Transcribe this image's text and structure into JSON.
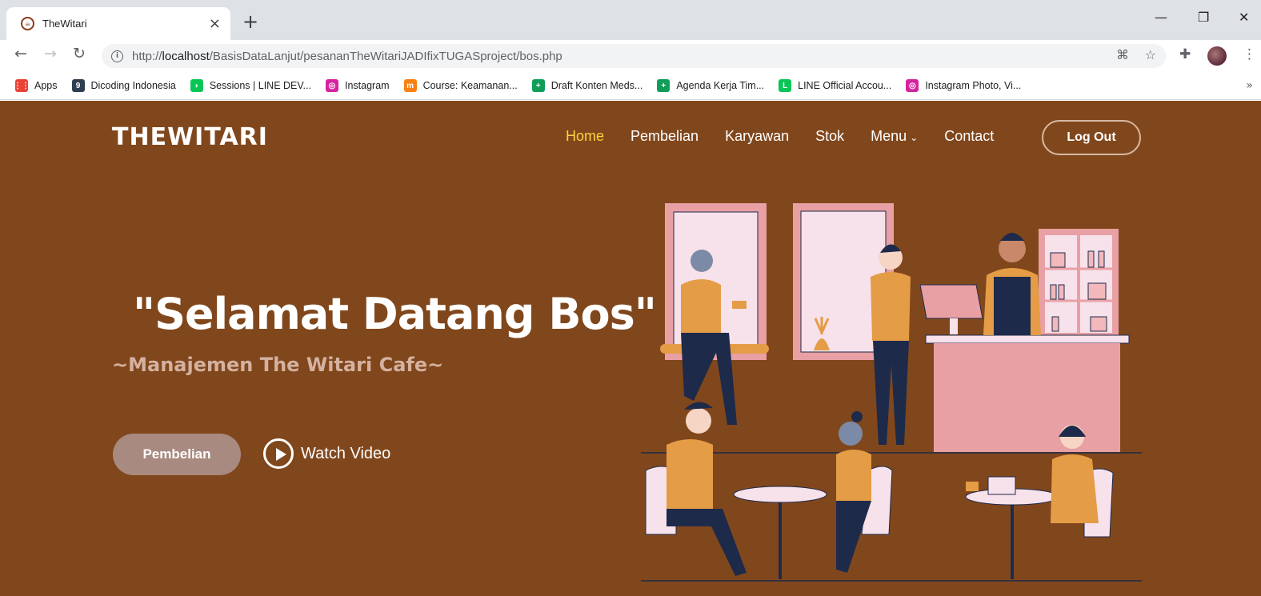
{
  "browser": {
    "tab": {
      "title": "TheWitari"
    },
    "url": {
      "domain_part": "http://",
      "host": "localhost",
      "path": "/BasisDataLanjut/pesananTheWitariJADIfixTUGASproject/bos.php"
    },
    "bookmarks": [
      {
        "label": "Apps",
        "icon": "apps-grid-icon",
        "color": "#ea4335"
      },
      {
        "label": "Dicoding Indonesia",
        "icon": "dicoding-icon",
        "color": "#2d3e50"
      },
      {
        "label": "Sessions | LINE DEV...",
        "icon": "line-dev-icon",
        "color": "#06c755"
      },
      {
        "label": "Instagram",
        "icon": "instagram-icon",
        "color": "#d6249f"
      },
      {
        "label": "Course: Keamanan...",
        "icon": "moodle-icon",
        "color": "#f98012"
      },
      {
        "label": "Draft Konten Meds...",
        "icon": "sheets-icon",
        "color": "#0f9d58"
      },
      {
        "label": "Agenda Kerja Tim...",
        "icon": "sheets-icon",
        "color": "#0f9d58"
      },
      {
        "label": "LINE Official Accou...",
        "icon": "line-icon",
        "color": "#06c755"
      },
      {
        "label": "Instagram Photo, Vi...",
        "icon": "instagram-icon",
        "color": "#d6249f"
      }
    ]
  },
  "site": {
    "logo": "THEWITARI",
    "nav": [
      {
        "label": "Home",
        "active": true
      },
      {
        "label": "Pembelian",
        "active": false
      },
      {
        "label": "Karyawan",
        "active": false
      },
      {
        "label": "Stok",
        "active": false
      },
      {
        "label": "Menu",
        "active": false,
        "dropdown": true
      },
      {
        "label": "Contact",
        "active": false
      }
    ],
    "logout_label": "Log Out",
    "hero": {
      "title": "\"Selamat Datang Bos\"",
      "subtitle": "~Manajemen The Witari Cafe~",
      "primary_button": "Pembelian",
      "video_button": "Watch Video"
    }
  },
  "colors": {
    "page_bg": "#81471c",
    "active_nav": "#ffd23f",
    "primary_button": "#a88a80",
    "subtitle": "#d4b1a0"
  }
}
